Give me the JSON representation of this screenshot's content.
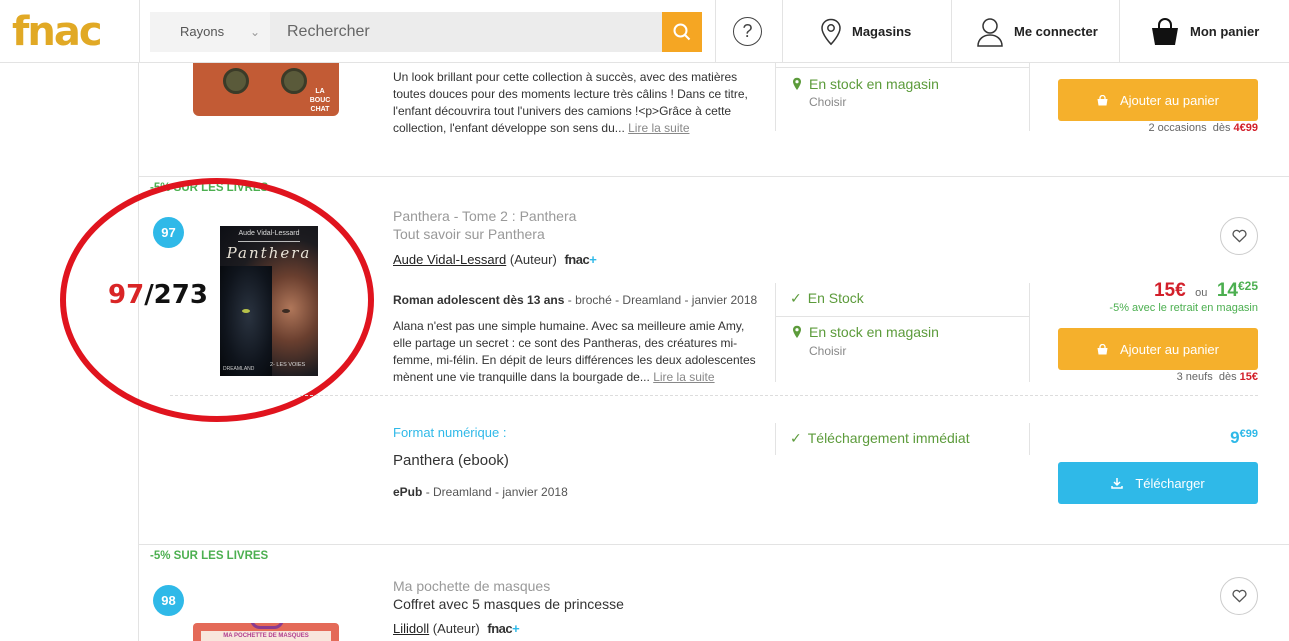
{
  "header": {
    "logo": "fnac",
    "rayons_label": "Rayons",
    "search_placeholder": "Rechercher",
    "help_label": "?",
    "stores_label": "Magasins",
    "login_label": "Me connecter",
    "cart_label": "Mon panier"
  },
  "colors": {
    "brand": "#e1a925",
    "cta": "#f5b02c",
    "download": "#2fb9e8",
    "price_red": "#d21f2a",
    "green": "#4caf50"
  },
  "prev_item": {
    "cover_badge": "LA BOUC CHAT",
    "description": "Un look brillant pour cette collection à succès, avec des matières toutes douces pour des moments lecture très câlins ! Dans ce titre, l'enfant découvrira tout l'univers des camions !<p>Grâce à cette collection, l'enfant développe son sens du...",
    "read_more": "Lire la suite",
    "stock_store": "En stock en magasin",
    "choose": "Choisir",
    "add_to_cart": "Ajouter au panier",
    "offers_prefix": "2 occasions",
    "offers_from": "dès",
    "offers_price": "4€99"
  },
  "item": {
    "promo": "-5% SUR LES LIVRES",
    "rank": "97",
    "annotation_num": "97",
    "annotation_total": "/273",
    "cover_author": "Aude Vidal-Lessard",
    "cover_title": "Panthera",
    "cover_subtitle": "2- LES VOIES",
    "cover_publisher": "DREAMLAND",
    "title_line1": "Panthera - Tome 2 : Panthera",
    "title_line2": "Tout savoir sur Panthera",
    "author_name": "Aude Vidal-Lessard",
    "author_role": "(Auteur)",
    "fnac_plus": "fnac",
    "fnac_plus_sign": "+",
    "category": "Roman adolescent dès 13 ans",
    "details": "- broché - Dreamland - janvier 2018",
    "description": "Alana n'est pas une simple humaine. Avec sa meilleure amie Amy, elle partage un secret  : ce sont des Pantheras, des créatures mi-femme, mi-félin. En dépit de leurs différences les deux adolescentes mènent une vie tranquille dans la bourgade de...",
    "read_more": "Lire la suite",
    "stock_online": "En Stock",
    "stock_store": "En stock en magasin",
    "choose": "Choisir",
    "price_main": "15€",
    "price_or": "ou",
    "price_alt_int": "14",
    "price_alt_dec": "€25",
    "price_note": "-5% avec le retrait en magasin",
    "add_to_cart": "Ajouter au panier",
    "offers_prefix": "3 neufs",
    "offers_from": "dès",
    "offers_price": "15€",
    "digital": {
      "label": "Format numérique :",
      "title": "Panthera (ebook)",
      "format": "ePub",
      "details": "- Dreamland - janvier 2018",
      "availability": "Téléchargement immédiat",
      "price_int": "9",
      "price_dec": "€99",
      "download": "Télécharger"
    }
  },
  "next_item": {
    "promo": "-5% SUR LES LIVRES",
    "rank": "98",
    "title_line1": "Ma pochette de masques",
    "title_line2": "Coffret avec 5 masques de princesse",
    "author_name": "Lilidoll",
    "author_role": "(Auteur)",
    "fnac_plus": "fnac",
    "fnac_plus_sign": "+",
    "cover_text": "MA POCHETTE DE MASQUES"
  }
}
